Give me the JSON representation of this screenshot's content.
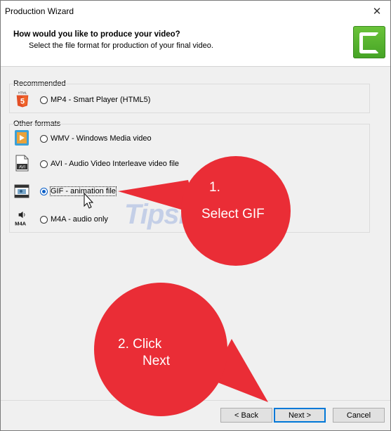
{
  "window": {
    "title": "Production Wizard",
    "close_glyph": "✕"
  },
  "header": {
    "question": "How would you like to produce your video?",
    "subtitle": "Select the file format for production of your final video."
  },
  "groups": {
    "recommended": "Recommended",
    "other": "Other formats"
  },
  "formats": [
    {
      "label": "MP4 - Smart Player (HTML5)",
      "icon": "html5-icon",
      "selected": false
    },
    {
      "label": "WMV - Windows Media video",
      "icon": "wmv-icon",
      "selected": false
    },
    {
      "label": "AVI - Audio Video Interleave video file",
      "icon": "avi-icon",
      "selected": false
    },
    {
      "label": "GIF - animation file",
      "icon": "gif-icon",
      "selected": true
    },
    {
      "label": "M4A - audio only",
      "icon": "m4a-icon",
      "selected": false
    }
  ],
  "icon_text": {
    "html": "HTML",
    "html5": "5",
    "avi": "AVI",
    "m4a": "M4A"
  },
  "buttons": {
    "back": "< Back",
    "next": "Next >",
    "cancel": "Cancel"
  },
  "watermark": {
    "text": "TipsMake",
    "suffix": ".com"
  },
  "annotations": {
    "step1_number": "1.",
    "step1_text": "Select GIF",
    "step2_line1": "2. Click",
    "step2_line2": "Next"
  },
  "colors": {
    "accent": "#0078d7",
    "brand": "#55b52e",
    "annotation": "#ea2d36",
    "html5": "#e34f26"
  }
}
